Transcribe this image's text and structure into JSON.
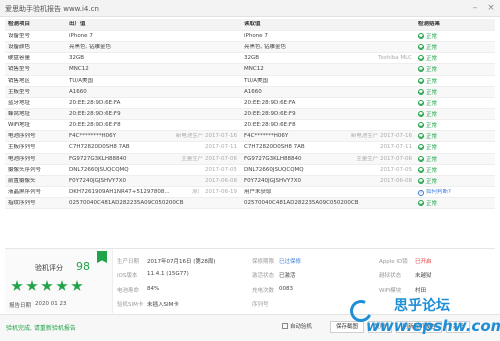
{
  "window": {
    "title": "爱思助手验机报告 www.i4.cn"
  },
  "table": {
    "headers": {
      "name": "检测项目",
      "factory": "出厂值",
      "device": "读取值",
      "result": "检测结果"
    },
    "rows": [
      {
        "name": "设备型号",
        "factory": "iPhone 7",
        "device": "iPhone 7",
        "note": "",
        "result": "正常",
        "status": "ok"
      },
      {
        "name": "设备颜色",
        "factory": "亮黑色, 钻雕金色",
        "device": "亮黑色, 钻雕金色",
        "note": "",
        "result": "正常",
        "status": "ok"
      },
      {
        "name": "硬盘容量",
        "factory": "32GB",
        "device": "32GB",
        "note": "Toshiba MLC",
        "result": "正常",
        "status": "ok"
      },
      {
        "name": "销售型号",
        "factory": "MNC12",
        "device": "MNC12",
        "note": "",
        "result": "正常",
        "status": "ok"
      },
      {
        "name": "销售地区",
        "factory": "TU/A美国",
        "device": "TU/A美国",
        "note": "",
        "result": "正常",
        "status": "ok"
      },
      {
        "name": "主板型号",
        "factory": "A1660",
        "device": "A1660",
        "note": "",
        "result": "正常",
        "status": "ok"
      },
      {
        "name": "蓝牙地址",
        "factory": "20:EE:28:9D:6E:FA",
        "device": "20:EE:28:9D:6E:FA",
        "note": "",
        "result": "正常",
        "status": "ok"
      },
      {
        "name": "蜂窝地址",
        "factory": "20:EE:28:9D:6E:F9",
        "device": "20:EE:28:9D:6E:F9",
        "note": "",
        "result": "正常",
        "status": "ok"
      },
      {
        "name": "WiFi地址",
        "factory": "20:EE:28:9D:6E:F8",
        "device": "20:EE:28:9D:6E:F8",
        "note": "",
        "result": "正常",
        "status": "ok"
      },
      {
        "name": "电池序列号",
        "factory": "F4C********H06Y",
        "factoryNote": "新电池生产 2017-07-16",
        "device": "F4C*******H06Y",
        "note": "新电池生产 2017-07-16",
        "result": "正常",
        "status": "ok"
      },
      {
        "name": "主板序列号",
        "factory": "C7H72820D0SH8 7AB",
        "factoryNote": "2017-07-11",
        "device": "C7H72820D0SH8 7AB",
        "note": "2017-07-11",
        "result": "正常",
        "status": "ok"
      },
      {
        "name": "电池序列号",
        "factory": "FG9727G3KLH88840",
        "factoryNote": "主量生产 2017-07-06",
        "device": "FG9727G3KLH88840",
        "note": "主量生产 2017-07-06",
        "result": "正常",
        "status": "ok"
      },
      {
        "name": "摄像头序列号",
        "factory": "DNL72660JSUQCQMQ",
        "factoryNote": "2017-07-05",
        "device": "DNL72660JSUQCQMQ",
        "note": "2017-07-05",
        "result": "正常",
        "status": "ok"
      },
      {
        "name": "前置摄像头",
        "factory": "F0Y7240JGJSHVY7X0",
        "factoryNote": "2017-06-08",
        "device": "F0Y7240JGJSHVY7X0",
        "note": "2017-06-08",
        "result": "正常",
        "status": "ok"
      },
      {
        "name": "液晶屏序列号",
        "factory": "DKH7261909AH1NR47+51297808...",
        "factoryNote": "原厂 2017-06-19",
        "device": "用户未获取",
        "note": "",
        "result": "如何判断?",
        "status": "warn"
      },
      {
        "name": "指纹序列号",
        "factory": "02570040C481AD282235A09C050200CB",
        "device": "02570040C481AD282235A09C050200CB",
        "note": "",
        "result": "正常",
        "status": "ok"
      }
    ]
  },
  "score": {
    "label": "验机评分",
    "value": "98",
    "stars": 5,
    "date_label": "报告日期",
    "date": "2020 01 23"
  },
  "info": {
    "production_date_label": "生产日期",
    "production_date": "2017年07月16日 (第28周)",
    "warranty_label": "保修期限",
    "warranty": "已过保修",
    "appleid_label": "Apple ID锁",
    "appleid": "已开启",
    "ios_label": "iOS版本",
    "ios": "11.4.1 (15G77)",
    "activation_label": "激活状态",
    "activation": "已激活",
    "jailbreak_label": "越狱状态",
    "jailbreak": "未越狱",
    "battery_label": "电池寿命",
    "battery": "84%",
    "charge_label": "充电次数",
    "charge": "0083",
    "wifi_label": "WiFi模块",
    "wifi": "村田",
    "sim_label": "验机SIM卡",
    "sim": "未插入SIM卡",
    "serial_label": "序列号",
    "serial": ""
  },
  "footer": {
    "link": "验机完成, 请重新验机报告",
    "checkbox": "自动验机",
    "buttons": [
      "保存截图",
      "复制",
      "刷新验机报告",
      "关闭"
    ]
  },
  "watermark": {
    "title": "思乎论坛",
    "url": "www.epshw.com"
  },
  "colors": {
    "accent": "#22a34a",
    "link": "#3a7ad8",
    "alert": "#e03a3a",
    "watermark": "#1e8fd6"
  }
}
